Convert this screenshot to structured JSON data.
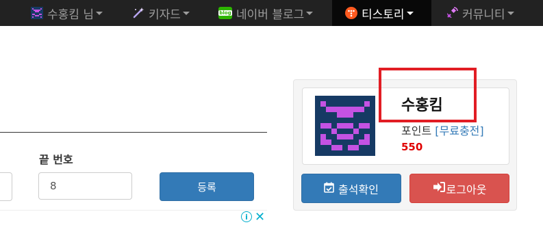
{
  "nav": {
    "user_label": "수홍킴 님",
    "keyword_label": "키자드",
    "naver_label": "네이버 블로그",
    "tistory_label": "티스토리",
    "community_label": "커뮤니티",
    "naver_badge": "blog"
  },
  "form": {
    "end_number_label": "끝 번호",
    "end_number_value": "8",
    "register_label": "등록"
  },
  "ad": {
    "info_glyph": "i",
    "close_glyph": "✕"
  },
  "profile": {
    "username": "수홍킴",
    "point_label": "포인트",
    "charge_link": "[무료충전]",
    "point_value": "550",
    "attend_label": "출석확인",
    "logout_label": "로그아웃"
  },
  "colors": {
    "navbar_bg": "#222222",
    "primary": "#337ab7",
    "danger": "#d9534f",
    "points": "#e00000",
    "highlight": "#e11d24",
    "avatar_bg": "#163a64",
    "avatar_fg": "#c452e3"
  },
  "icons": [
    "grid-avatar-icon",
    "magic-wand-icon",
    "naver-blog-icon",
    "tistory-icon",
    "satellite-icon",
    "calendar-check-icon",
    "sign-out-icon",
    "info-icon",
    "close-icon"
  ]
}
